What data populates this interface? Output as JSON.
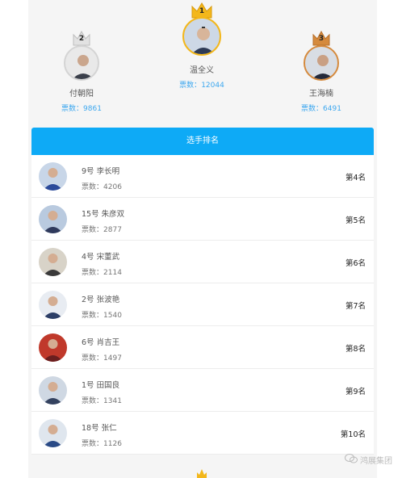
{
  "podium": {
    "first": {
      "rank": "1",
      "name": "温全义",
      "votes_label": "票数：",
      "votes": "12044",
      "crown_color": "#f3b71b"
    },
    "second": {
      "rank": "2",
      "name": "付朝阳",
      "votes_label": "票数：",
      "votes": "9861",
      "crown_color": "#d9d9d9"
    },
    "third": {
      "rank": "3",
      "name": "王海楠",
      "votes_label": "票数：",
      "votes": "6491",
      "crown_color": "#d58a3d"
    }
  },
  "ranking_header": "选手排名",
  "rows": [
    {
      "name": "9号 李长明",
      "votes_label": "票数：",
      "votes": "4206",
      "rank": "第4名",
      "shirt": "#2b4a9a",
      "bg": "#c8d6e8"
    },
    {
      "name": "15号 朱彦双",
      "votes_label": "票数：",
      "votes": "2877",
      "rank": "第5名",
      "shirt": "#2f3a5c",
      "bg": "#b9cadf"
    },
    {
      "name": "4号 宋董武",
      "votes_label": "票数：",
      "votes": "2114",
      "rank": "第6名",
      "shirt": "#3a3a3a",
      "bg": "#d8d3c8"
    },
    {
      "name": "2号 张波艳",
      "votes_label": "票数：",
      "votes": "1540",
      "rank": "第7名",
      "shirt": "#2c3e66",
      "bg": "#e8ecf2"
    },
    {
      "name": "6号 肖吉王",
      "votes_label": "票数：",
      "votes": "1497",
      "rank": "第8名",
      "shirt": "#6b1f1f",
      "bg": "#c0392b"
    },
    {
      "name": "1号 田国良",
      "votes_label": "票数：",
      "votes": "1341",
      "rank": "第9名",
      "shirt": "#34425f",
      "bg": "#cfd8e3"
    },
    {
      "name": "18号 张仁",
      "votes_label": "票数：",
      "votes": "1126",
      "rank": "第10名",
      "shirt": "#2a4a86",
      "bg": "#dfe6ee"
    }
  ],
  "watermark": "鸿展集团",
  "colors": {
    "accent": "#0eaaf6",
    "votes_blue": "#3ea8ef"
  }
}
